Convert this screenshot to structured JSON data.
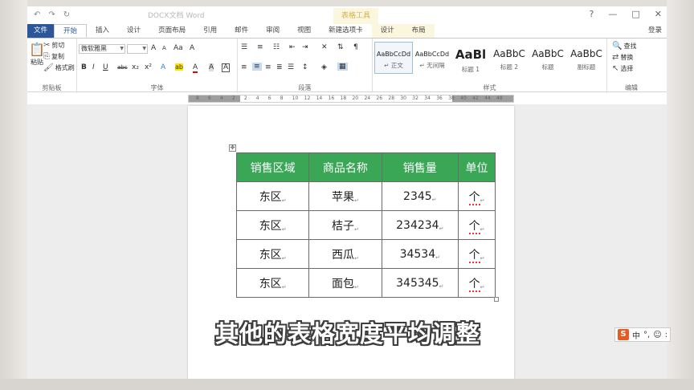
{
  "title": {
    "qat": [
      "↶",
      "↷",
      "↻"
    ],
    "document": "DOCX文档 Word",
    "contextual": "表格工具",
    "controls": [
      "?",
      "—",
      "□",
      "✕"
    ]
  },
  "tabs": [
    "文件",
    "开始",
    "插入",
    "设计",
    "页面布局",
    "引用",
    "邮件",
    "审阅",
    "视图",
    "新建选项卡",
    "设计",
    "布局",
    "登录"
  ],
  "ribbon": {
    "clipboard": {
      "label": "剪贴板",
      "paste": "粘贴",
      "cut": "剪切",
      "copy": "复制",
      "painter": "格式刷"
    },
    "font": {
      "label": "字体",
      "name": "微软雅黑",
      "size": "",
      "grow": "A",
      "shrink": "A",
      "case": "Aa",
      "clear": "A",
      "bold": "B",
      "italic": "I",
      "underline": "U",
      "strike": "abc",
      "sub": "x₂",
      "sup": "x²",
      "effects": "A",
      "highlight": "ab",
      "color": "A",
      "shade": "A",
      "border": "A"
    },
    "paragraph": {
      "label": "段落"
    },
    "styles": {
      "label": "样式",
      "items": [
        {
          "preview": "AaBbCcDd",
          "name": "↵ 正文"
        },
        {
          "preview": "AaBbCcDd",
          "name": "↵ 无间隔"
        },
        {
          "preview": "AaBl",
          "name": "标题 1"
        },
        {
          "preview": "AaBbC",
          "name": "标题 2"
        },
        {
          "preview": "AaBbC",
          "name": "标题"
        },
        {
          "preview": "AaBbC",
          "name": "副标题"
        }
      ]
    },
    "editing": {
      "label": "编辑",
      "find": "查找",
      "replace": "替换",
      "select": "选择"
    }
  },
  "ruler": [
    "8",
    "6",
    "4",
    "2",
    "2",
    "4",
    "6",
    "8",
    "10",
    "12",
    "14",
    "16",
    "18",
    "20",
    "24",
    "26",
    "28",
    "30",
    "32",
    "34",
    "36",
    "38",
    "40",
    "42",
    "44",
    "48"
  ],
  "table": {
    "headers": [
      "销售区域",
      "商品名称",
      "销售量",
      "单位"
    ],
    "rows": [
      [
        "东区",
        "苹果",
        "2345",
        "个"
      ],
      [
        "东区",
        "桔子",
        "234234",
        "个"
      ],
      [
        "东区",
        "西瓜",
        "34534",
        "个"
      ],
      [
        "东区",
        "面包",
        "345345",
        "个"
      ]
    ],
    "paragraph_mark": "↵",
    "move_handle": "✥"
  },
  "subtitle": "其他的表格宽度平均调整",
  "ime": {
    "logo": "S",
    "mode": "中",
    "punct": "°,",
    "emoji": "☺",
    "extra": ":"
  },
  "colors": {
    "header_green": "#3aa756",
    "file_tab": "#2b579a"
  }
}
